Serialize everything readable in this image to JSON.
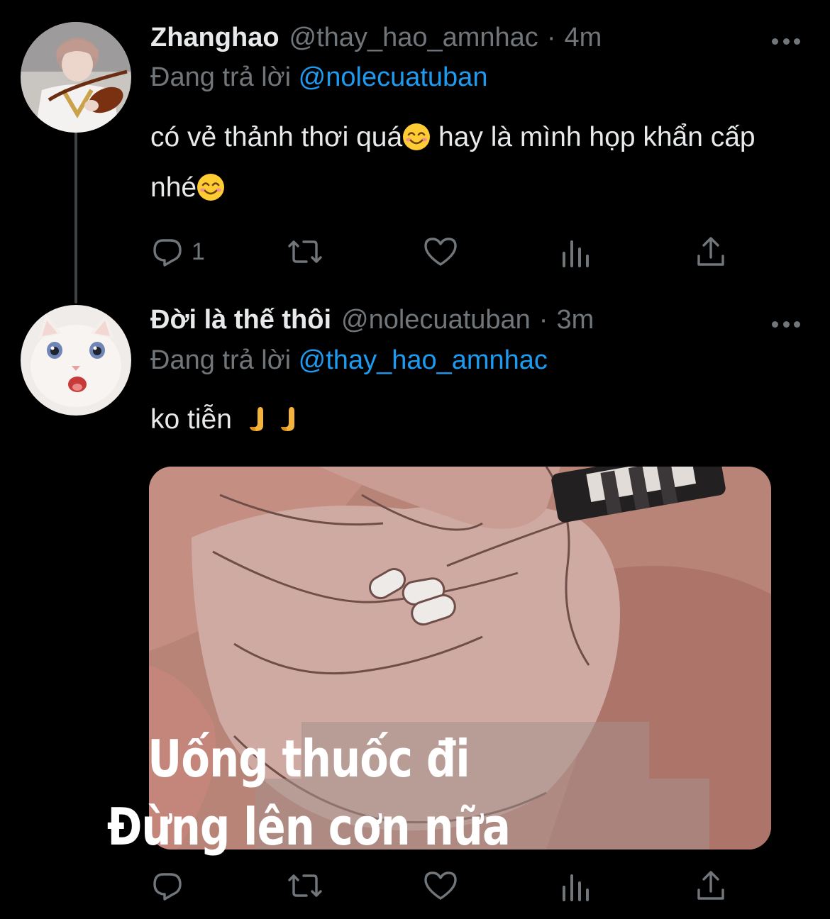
{
  "tweets": [
    {
      "display_name": "Zhanghao",
      "handle": "@thay_hao_amnhac",
      "separator": "·",
      "time": "4m",
      "reply_prefix": "Đang trả lời",
      "reply_to": "@nolecuatuban",
      "text_part1": "có vẻ thảnh thơi quá",
      "text_part2": "  hay là mình họp khẩn cấp nhé",
      "reply_count": "1",
      "avatar_icon": "violinist-avatar",
      "emoji": "smiling-face-icon"
    },
    {
      "display_name": "Đời là thế thôi",
      "handle": "@nolecuatuban",
      "separator": "·",
      "time": "3m",
      "reply_prefix": "Đang trả lời",
      "reply_to": "@thay_hao_amnhac",
      "text": "ko tiễn",
      "avatar_icon": "white-cat-avatar",
      "emoji": "folded-hands-icon",
      "media": {
        "caption_line1": "Uống thuốc đi",
        "caption_line2": "Đừng lên cơn nữa"
      }
    }
  ],
  "colors": {
    "background": "#000000",
    "text": "#e7e9ea",
    "secondary": "#71767b",
    "link": "#1d9bf0",
    "thread_line": "#3d4246"
  }
}
